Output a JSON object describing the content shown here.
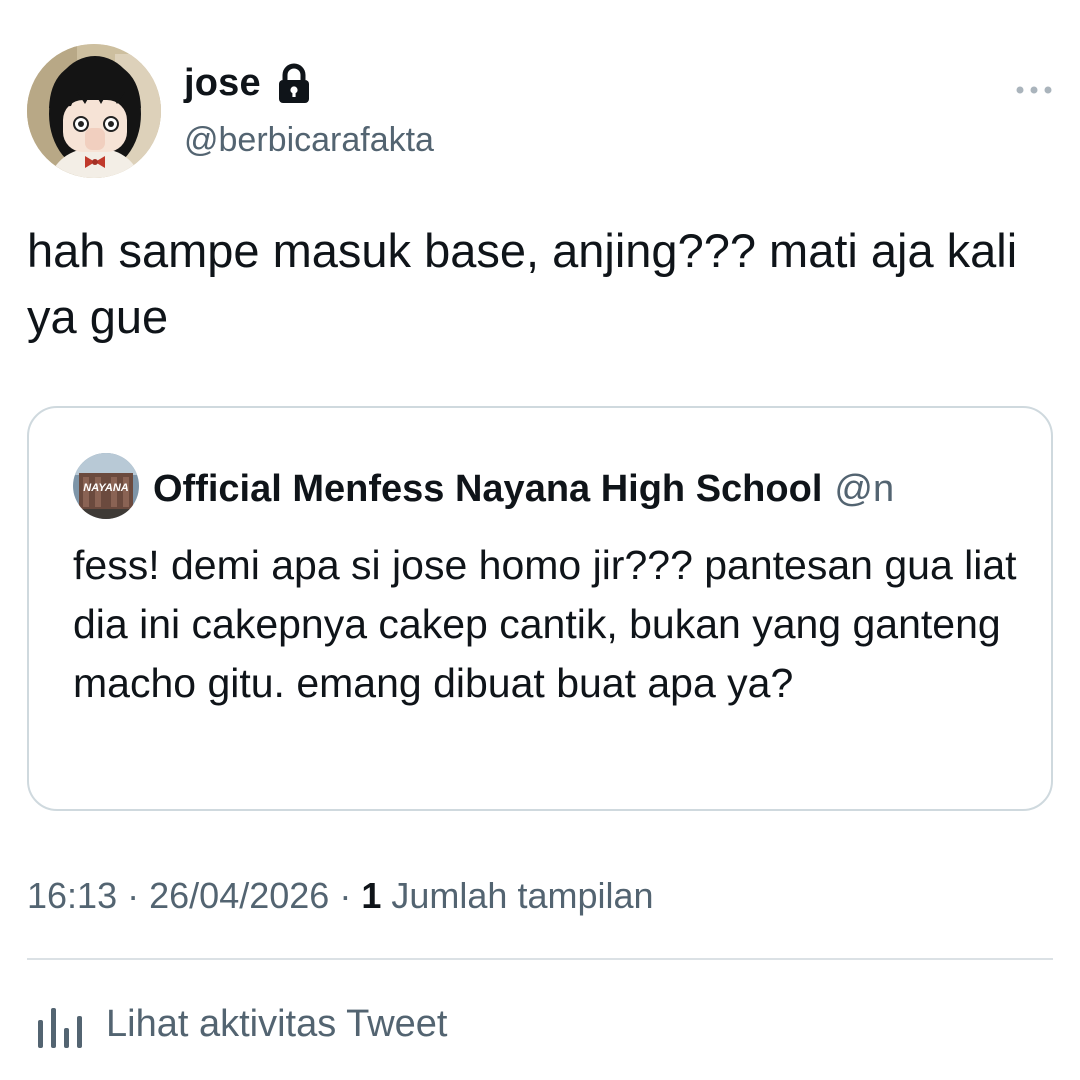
{
  "author": {
    "display_name": "jose",
    "handle": "@berbicarafakta",
    "avatar": "anime-girl-avatar",
    "protected_icon": "lock-icon"
  },
  "more_icon": "more-horizontal-icon",
  "tweet": {
    "text": "hah sampe masuk base, anjing??? mati aja kali ya gue"
  },
  "quote": {
    "display_name": "Official Menfess Nayana High School",
    "handle": "@n",
    "avatar_text": "NAYANA",
    "text": "fess! demi apa si jose homo jir??? pantesan gua liat dia ini cakepnya cakep cantik, bukan yang ganteng macho gitu. emang dibuat buat apa ya?"
  },
  "meta": {
    "time": "16:13",
    "separator": "·",
    "date": "26/04/2026",
    "views_count": "1",
    "views_label": "Jumlah tampilan"
  },
  "activity": {
    "label": "Lihat aktivitas Tweet",
    "icon": "analytics-bars-icon"
  },
  "colors": {
    "text_primary": "#0f1419",
    "text_secondary": "#536471",
    "border": "#cfd9de"
  }
}
